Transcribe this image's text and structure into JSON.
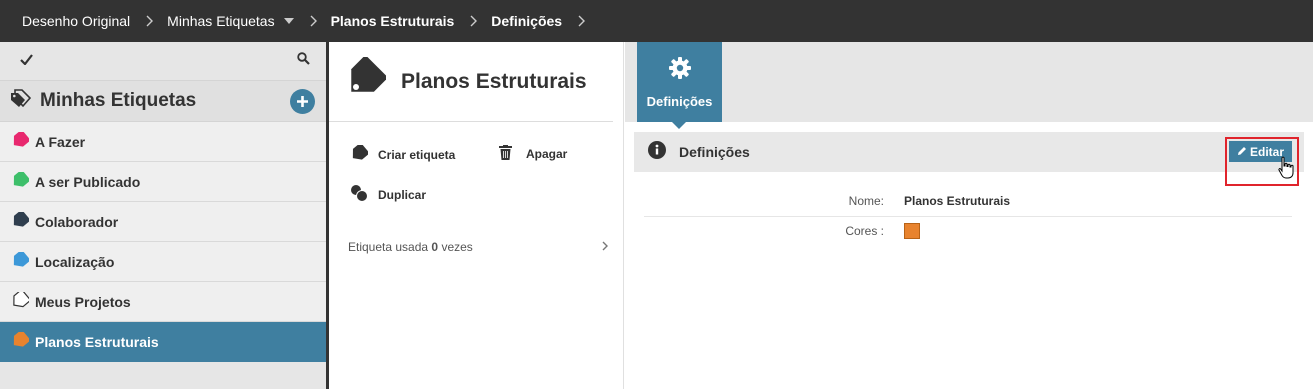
{
  "breadcrumb": {
    "items": [
      {
        "label": "Desenho Original"
      },
      {
        "label": "Minhas Etiquetas"
      },
      {
        "label": "Planos Estruturais"
      },
      {
        "label": "Definições"
      }
    ]
  },
  "sidebar": {
    "title": "Minhas Etiquetas",
    "tags": [
      {
        "label": "A Fazer",
        "color": "#e8286e"
      },
      {
        "label": "A ser Publicado",
        "color": "#3dbf6a"
      },
      {
        "label": "Colaborador",
        "color": "#2f3e4e"
      },
      {
        "label": "Localização",
        "color": "#3c98d8"
      },
      {
        "label": "Meus Projetos",
        "color": "#ffffff"
      },
      {
        "label": "Planos Estruturais",
        "color": "#e8832e"
      }
    ]
  },
  "middle": {
    "title": "Planos Estruturais",
    "actions": {
      "create": "Criar etiqueta",
      "delete": "Apagar",
      "duplicate": "Duplicar"
    },
    "usage": {
      "prefix": "Etiqueta usada",
      "count": "0",
      "suffix": "vezes"
    }
  },
  "right": {
    "tab_label": "Definições",
    "section_title": "Definições",
    "edit_label": "Editar",
    "fields": {
      "name_label": "Nome:",
      "name_value": "Planos Estruturais",
      "colors_label": "Cores :",
      "color_value": "#e8832e"
    }
  },
  "colors": {
    "accent": "#3f7fa0",
    "topbar": "#333333",
    "highlight_box": "#e0242c"
  }
}
